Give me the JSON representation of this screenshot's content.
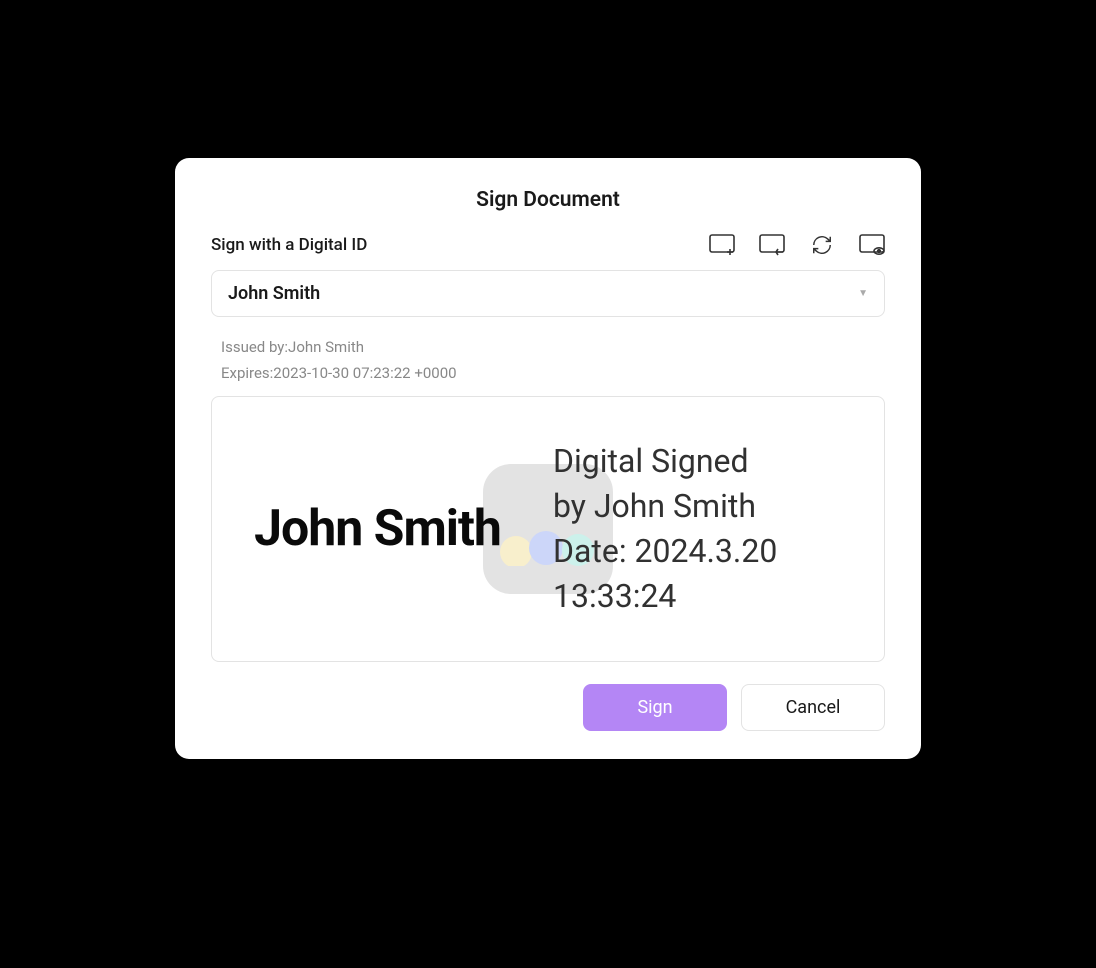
{
  "dialog": {
    "title": "Sign Document",
    "section_label": "Sign with a Digital ID"
  },
  "select": {
    "value": "John Smith"
  },
  "meta": {
    "issued_by": "Issued by:John Smith",
    "expires": "Expires:2023-10-30 07:23:22 +0000"
  },
  "preview": {
    "name": "John Smith",
    "line1": "Digital Signed",
    "line2": "by John Smith",
    "line3": "Date: 2024.3.20",
    "line4": "13:33:24"
  },
  "buttons": {
    "sign": "Sign",
    "cancel": "Cancel"
  },
  "colors": {
    "accent": "#b486f5"
  }
}
